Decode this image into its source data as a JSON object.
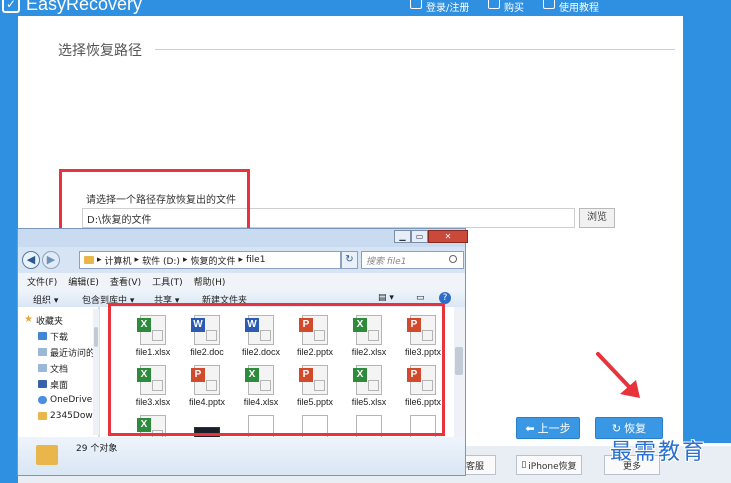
{
  "app": {
    "title": "EasyRecovery",
    "header_links": [
      "登录/注册",
      "购买",
      "使用教程"
    ]
  },
  "main": {
    "section_title": "选择恢复路径",
    "hint": "请选择一个路径存放恢复出的文件",
    "path_value": "D:\\恢复的文件",
    "browse_label": "浏览",
    "prev_label": "上一步",
    "recover_label": "恢复"
  },
  "bottom_bar": {
    "buttons": [
      "客服",
      "iPhone恢复",
      "更多"
    ]
  },
  "explorer": {
    "breadcrumb": [
      "计算机",
      "软件 (D:)",
      "恢复的文件",
      "file1"
    ],
    "search_placeholder": "搜索 file1",
    "menu": [
      "文件(F)",
      "编辑(E)",
      "查看(V)",
      "工具(T)",
      "帮助(H)"
    ],
    "toolbar": [
      "组织 ▾",
      "包含到库中 ▾",
      "共享 ▾",
      "新建文件夹"
    ],
    "nav_items": [
      "收藏夹",
      "下载",
      "最近访问的",
      "文档",
      "桌面",
      "OneDrive",
      "2345Dow"
    ],
    "files": [
      {
        "name": "file1.xlsx",
        "type": "xlsx"
      },
      {
        "name": "file2.doc",
        "type": "doc"
      },
      {
        "name": "file2.docx",
        "type": "doc"
      },
      {
        "name": "file2.pptx",
        "type": "pptx"
      },
      {
        "name": "file2.xlsx",
        "type": "xlsx"
      },
      {
        "name": "file3.pptx",
        "type": "pptx"
      },
      {
        "name": "file3.xlsx",
        "type": "xlsx"
      },
      {
        "name": "file4.pptx",
        "type": "pptx"
      },
      {
        "name": "file4.xlsx",
        "type": "xlsx"
      },
      {
        "name": "file5.pptx",
        "type": "pptx"
      },
      {
        "name": "file5.xlsx",
        "type": "xlsx"
      },
      {
        "name": "file6.pptx",
        "type": "pptx"
      }
    ],
    "status_text": "29 个对象"
  },
  "watermark": "最需教育",
  "colors": {
    "brand_blue": "#2f8fe0",
    "highlight_red": "#e8323c",
    "excel_green": "#2e8b3c",
    "word_blue": "#2d5ab3",
    "ppt_orange": "#d04a2b"
  }
}
